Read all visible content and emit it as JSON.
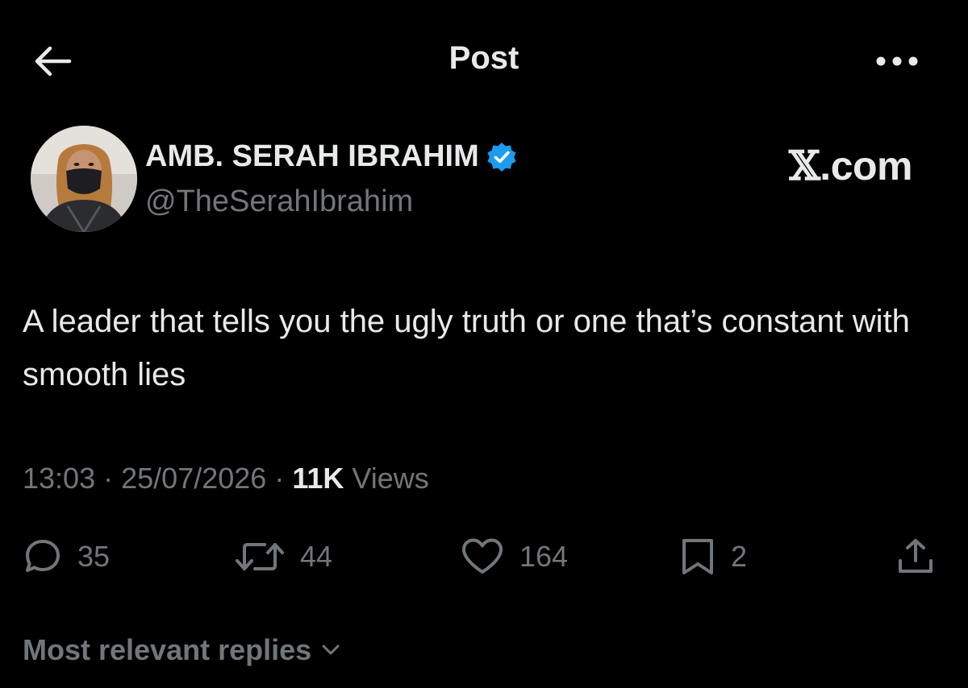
{
  "header": {
    "title": "Post",
    "back_icon": "arrow-left-icon",
    "more_icon": "more-horizontal-icon"
  },
  "author": {
    "name": "AMB. SERAH IBRAHIM",
    "handle": "@TheSerahIbrahim",
    "verified": true,
    "verified_color": "#1d9bf0"
  },
  "watermark": {
    "letter": "𝕏",
    "suffix": ".com"
  },
  "post": {
    "text": "A leader that tells you the ugly truth or one that’s constant with smooth lies",
    "time": "13:03",
    "separator": "·",
    "date": "25/07/2026",
    "views_count": "11K",
    "views_label": "Views"
  },
  "actions": {
    "replies": "35",
    "reposts": "44",
    "likes": "164",
    "bookmarks": "2",
    "icons": [
      "reply-icon",
      "repost-icon",
      "like-icon",
      "bookmark-icon",
      "share-icon"
    ]
  },
  "replies_sort": {
    "label": "Most relevant replies"
  },
  "colors": {
    "background": "#000000",
    "primary_text": "#e7e9ea",
    "secondary_text": "#71767b",
    "accent": "#1d9bf0"
  }
}
